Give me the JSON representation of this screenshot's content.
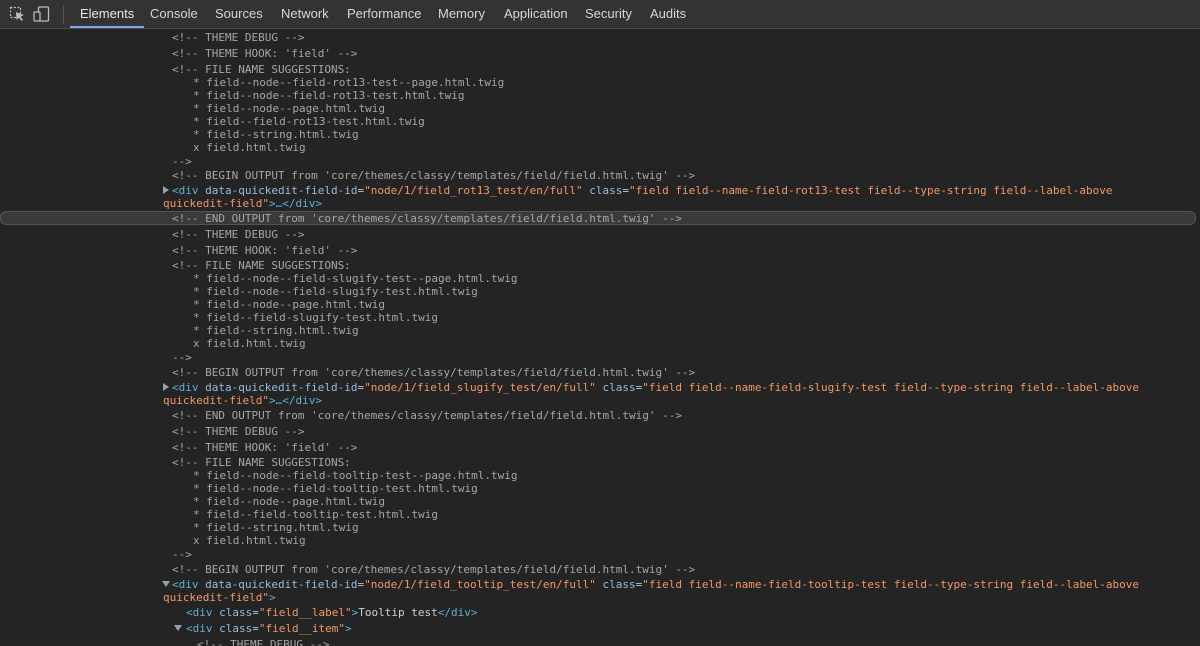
{
  "toolbar": {
    "inspect_icon": "cursor-inspect-icon",
    "device_icon": "device-toolbar-icon",
    "tabs": [
      "Elements",
      "Console",
      "Sources",
      "Network",
      "Performance",
      "Memory",
      "Application",
      "Security",
      "Audits"
    ],
    "active_tab": "Elements",
    "accent_color": "#7fa6e8"
  },
  "colors": {
    "background": "#242424",
    "comment": "#a6a6a6",
    "tag": "#5db0d7",
    "attribute_name": "#9bbbdc",
    "attribute_value": "#f29766"
  },
  "dom": {
    "block1": {
      "theme_debug": "<!-- THEME DEBUG -->",
      "theme_hook": "<!-- THEME HOOK: 'field' -->",
      "suggestions_header": "<!-- FILE NAME SUGGESTIONS:",
      "suggestions": [
        "* field--node--field-rot13-test--page.html.twig",
        "* field--node--field-rot13-test.html.twig",
        "* field--node--page.html.twig",
        "* field--field-rot13-test.html.twig",
        "* field--string.html.twig",
        "x field.html.twig"
      ],
      "comment_close": "-->",
      "begin_output": "<!-- BEGIN OUTPUT from 'core/themes/classy/templates/field/field.html.twig' -->",
      "div_open": "<div",
      "attr1_name": "data-quickedit-field-id",
      "attr1_value": "\"node/1/field_rot13_test/en/full\"",
      "attr2_name": "class",
      "attr2_value_line1": "\"field field--name-field-rot13-test field--type-string field--label-above",
      "attr2_value_line2": "quickedit-field\"",
      "close_part": ">…</div>",
      "end_output": "<!-- END OUTPUT from 'core/themes/classy/templates/field/field.html.twig' -->"
    },
    "block2": {
      "theme_debug": "<!-- THEME DEBUG -->",
      "theme_hook": "<!-- THEME HOOK: 'field' -->",
      "suggestions_header": "<!-- FILE NAME SUGGESTIONS:",
      "suggestions": [
        "* field--node--field-slugify-test--page.html.twig",
        "* field--node--field-slugify-test.html.twig",
        "* field--node--page.html.twig",
        "* field--field-slugify-test.html.twig",
        "* field--string.html.twig",
        "x field.html.twig"
      ],
      "comment_close": "-->",
      "begin_output": "<!-- BEGIN OUTPUT from 'core/themes/classy/templates/field/field.html.twig' -->",
      "div_open": "<div",
      "attr1_name": "data-quickedit-field-id",
      "attr1_value": "\"node/1/field_slugify_test/en/full\"",
      "attr2_name": "class",
      "attr2_value_line1": "\"field field--name-field-slugify-test field--type-string field--label-above",
      "attr2_value_line2": "quickedit-field\"",
      "close_part": ">…</div>",
      "end_output": "<!-- END OUTPUT from 'core/themes/classy/templates/field/field.html.twig' -->"
    },
    "block3": {
      "theme_debug": "<!-- THEME DEBUG -->",
      "theme_hook": "<!-- THEME HOOK: 'field' -->",
      "suggestions_header": "<!-- FILE NAME SUGGESTIONS:",
      "suggestions": [
        "* field--node--field-tooltip-test--page.html.twig",
        "* field--node--field-tooltip-test.html.twig",
        "* field--node--page.html.twig",
        "* field--field-tooltip-test.html.twig",
        "* field--string.html.twig",
        "x field.html.twig"
      ],
      "comment_close": "-->",
      "begin_output": "<!-- BEGIN OUTPUT from 'core/themes/classy/templates/field/field.html.twig' -->",
      "div_open": "<div",
      "attr1_name": "data-quickedit-field-id",
      "attr1_value": "\"node/1/field_tooltip_test/en/full\"",
      "attr2_name": "class",
      "attr2_value_line1": "\"field field--name-field-tooltip-test field--type-string field--label-above",
      "attr2_value_line2": "quickedit-field\"",
      "close_part": ">",
      "label_div_open": "<div",
      "label_attr_name": "class",
      "label_attr_value": "\"field__label\"",
      "label_gt": ">",
      "label_text": "Tooltip test",
      "label_close": "</div>",
      "item_div_open": "<div",
      "item_attr_name": "class",
      "item_attr_value": "\"field__item\"",
      "item_gt": ">",
      "last_comment": "<!-- THEME DEBUG -->"
    }
  }
}
